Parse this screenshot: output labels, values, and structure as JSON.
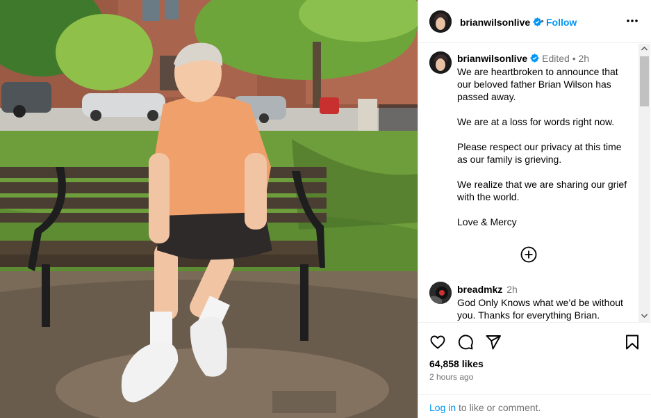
{
  "header": {
    "username": "brianwilsonlive",
    "separator": "•",
    "follow_label": "Follow"
  },
  "caption": {
    "username": "brianwilsonlive",
    "meta": "Edited • 2h",
    "paragraphs": [
      "We are heartbroken to announce that our beloved father Brian Wilson has passed away.",
      "We are at a loss for words right now.",
      "Please respect our privacy at this time as our family is grieving.",
      "We realize that we are sharing our grief with the world.",
      "Love & Mercy"
    ]
  },
  "comment": {
    "username": "breadmkz",
    "time": "2h",
    "text": "God Only Knows what we’d be without you. Thanks for everything Brian."
  },
  "footer": {
    "likes": "64,858 likes",
    "posted_ago": "2 hours ago",
    "login_link": "Log in",
    "login_rest": " to like or comment."
  },
  "icons": {
    "verified": "verified-badge-icon",
    "more": "more-options-icon",
    "load_more": "load-more-comments-icon",
    "like": "heart-icon",
    "comment": "comment-icon",
    "share": "share-icon",
    "save": "bookmark-icon"
  },
  "colors": {
    "link": "#0095f6",
    "verified": "#0095f6",
    "muted": "#737373",
    "shirt": "#f0a06a"
  }
}
